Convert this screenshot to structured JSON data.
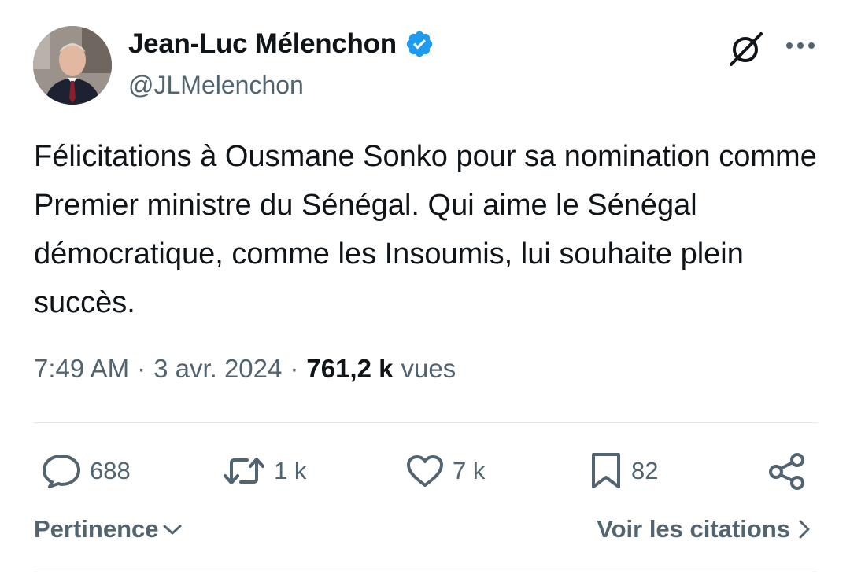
{
  "author": {
    "display_name": "Jean-Luc Mélenchon",
    "handle": "@JLMelenchon",
    "verified": true,
    "verified_color": "#1d9bf0"
  },
  "header_icons": [
    "grok-icon",
    "more-options-icon"
  ],
  "tweet": {
    "text": "Félicitations à Ousmane Sonko pour sa nomination comme Premier ministre du Sénégal. Qui aime le Sénégal démocratique, comme les Insoumis, lui souhaite plein succès.",
    "time": "7:49 AM",
    "date": "3 avr. 2024",
    "separator": "·",
    "views_count": "761,2 k",
    "views_label": "vues"
  },
  "actions": {
    "replies": "688",
    "retweets": "1 k",
    "likes": "7 k",
    "bookmarks": "82"
  },
  "footer": {
    "sort_label": "Pertinence",
    "quotes_label": "Voir les citations"
  },
  "colors": {
    "text_primary": "#0f1419",
    "text_secondary": "#536471",
    "divider": "#e6e9ec"
  }
}
